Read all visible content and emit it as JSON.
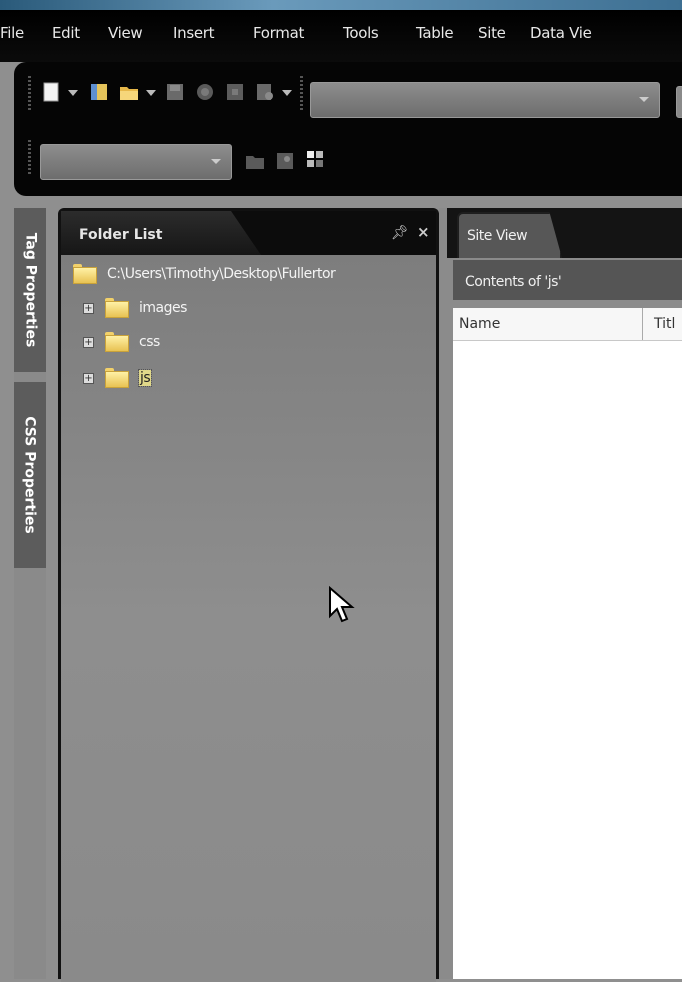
{
  "menu": [
    "File",
    "Edit",
    "View",
    "Insert",
    "Format",
    "Tools",
    "Table",
    "Site",
    "Data Vie"
  ],
  "side_tabs": {
    "tag_properties": "Tag Properties",
    "css_properties": "CSS Properties"
  },
  "folder_list": {
    "title": "Folder List",
    "root": "C:\\Users\\Timothy\\Desktop\\Fullertor",
    "items": [
      {
        "label": "images",
        "expander": "+"
      },
      {
        "label": "css",
        "expander": "+"
      },
      {
        "label": "js",
        "expander": "+",
        "selected": true
      }
    ]
  },
  "site_view": {
    "tab": "Site View",
    "contents_label": "Contents of 'js'",
    "columns": [
      "Name",
      "Titl"
    ]
  },
  "icons": [
    "new-page-icon",
    "new-folder-icon",
    "open-icon",
    "save-icon",
    "publish-icon",
    "preview-icon",
    "print-icon",
    "pin-icon",
    "close-icon",
    "mouse-cursor-icon"
  ],
  "colors": {
    "menu_bg": "#000000",
    "panel_bg": "#7a7a7a",
    "folder_yellow": "#f4d774",
    "selection": "#e0d88a"
  }
}
